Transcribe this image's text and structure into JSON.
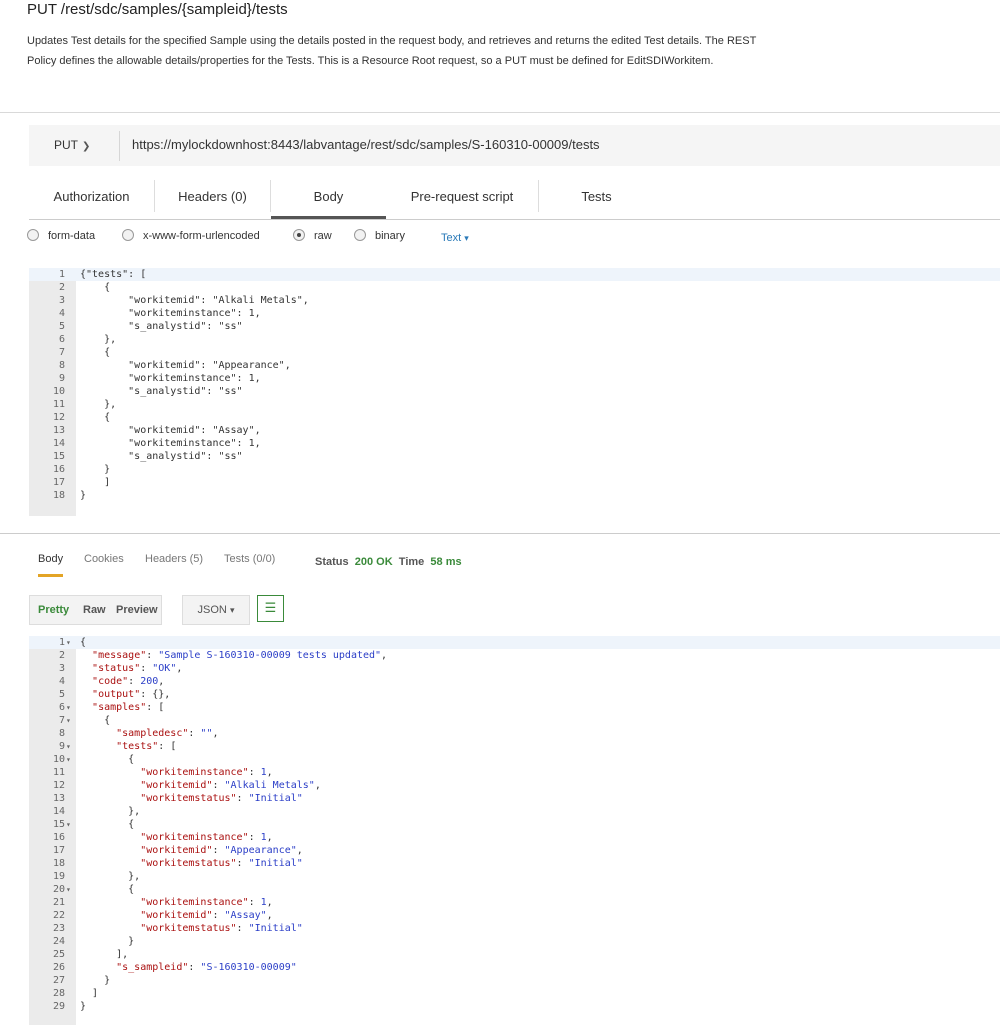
{
  "header": {
    "title": "PUT /rest/sdc/samples/{sampleid}/tests",
    "description": "Updates Test details for the specified Sample using the details posted in the request body, and retrieves and returns the edited Test details. The REST Policy defines the allowable details/properties for the Tests. This is a Resource Root request, so a PUT must be defined for EditSDIWorkitem."
  },
  "request": {
    "method": "PUT",
    "url": "https://mylockdownhost:8443/labvantage/rest/sdc/samples/S-160310-00009/tests",
    "tabs": [
      "Authorization",
      "Headers (0)",
      "Body",
      "Pre-request script",
      "Tests"
    ],
    "active_tab": "Body",
    "body_types": [
      "form-data",
      "x-www-form-urlencoded",
      "raw",
      "binary"
    ],
    "selected_body_type": "raw",
    "content_type": "Text",
    "body_lines": [
      "{\"tests\": [",
      "    {",
      "        \"workitemid\": \"Alkali Metals\",",
      "        \"workiteminstance\": 1,",
      "        \"s_analystid\": \"ss\"",
      "    },",
      "    {",
      "        \"workitemid\": \"Appearance\",",
      "        \"workiteminstance\": 1,",
      "        \"s_analystid\": \"ss\"",
      "    },",
      "    {",
      "        \"workitemid\": \"Assay\",",
      "        \"workiteminstance\": 1,",
      "        \"s_analystid\": \"ss\"",
      "    }",
      "    ]",
      "}"
    ]
  },
  "response": {
    "tabs": [
      "Body",
      "Cookies",
      "Headers (5)",
      "Tests (0/0)"
    ],
    "active_tab": "Body",
    "status_label": "Status",
    "status_value": "200 OK",
    "time_label": "Time",
    "time_value": "58 ms",
    "view_modes": [
      "Pretty",
      "Raw",
      "Preview"
    ],
    "active_view": "Pretty",
    "format": "JSON",
    "body_lines": [
      "{",
      "  \"message\": \"Sample S-160310-00009 tests updated\",",
      "  \"status\": \"OK\",",
      "  \"code\": 200,",
      "  \"output\": {},",
      "  \"samples\": [",
      "    {",
      "      \"sampledesc\": \"\",",
      "      \"tests\": [",
      "        {",
      "          \"workiteminstance\": 1,",
      "          \"workitemid\": \"Alkali Metals\",",
      "          \"workitemstatus\": \"Initial\"",
      "        },",
      "        {",
      "          \"workiteminstance\": 1,",
      "          \"workitemid\": \"Appearance\",",
      "          \"workitemstatus\": \"Initial\"",
      "        },",
      "        {",
      "          \"workiteminstance\": 1,",
      "          \"workitemid\": \"Assay\",",
      "          \"workitemstatus\": \"Initial\"",
      "        }",
      "      ],",
      "      \"s_sampleid\": \"S-160310-00009\"",
      "    }",
      "  ]",
      "}"
    ],
    "fold_lines": [
      1,
      6,
      7,
      9,
      10,
      15,
      20
    ]
  },
  "colors": {
    "accent_orange": "#e3a426",
    "status_green": "#3a8a3a",
    "link_blue": "#2a7ab8"
  }
}
